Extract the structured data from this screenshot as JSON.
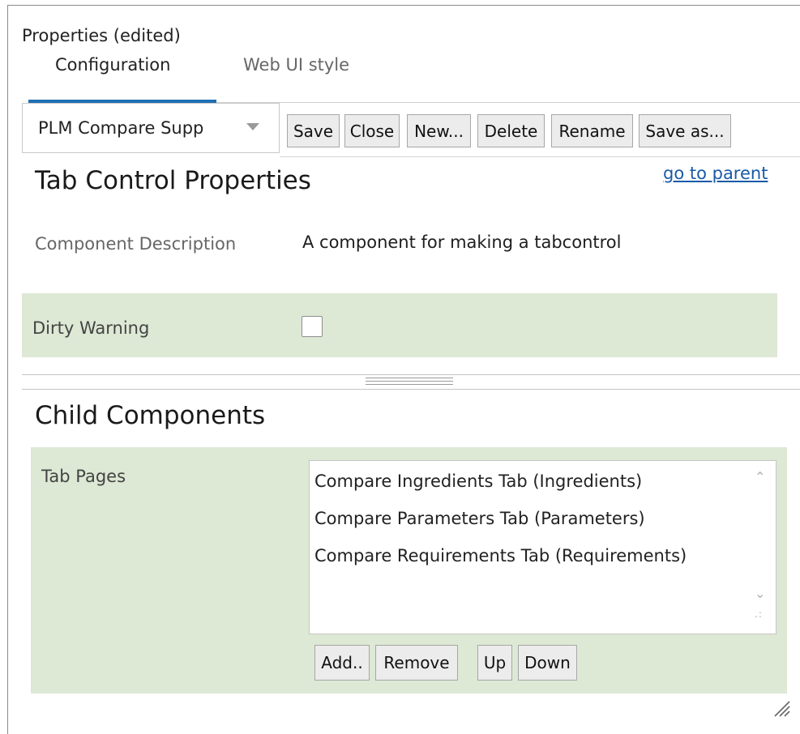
{
  "panel": {
    "title": "Properties (edited)"
  },
  "tabs": [
    {
      "label": "Configuration",
      "active": true
    },
    {
      "label": "Web UI style",
      "active": false
    }
  ],
  "toolbar": {
    "combo_value": "PLM Compare Supp",
    "buttons": [
      "Save",
      "Close",
      "New...",
      "Delete",
      "Rename",
      "Save as..."
    ]
  },
  "properties": {
    "title": "Tab Control Properties",
    "parent_link": "go to parent",
    "component_description_label": "Component Description",
    "component_description_value": "A component for making a tabcontrol",
    "dirty_warning_label": "Dirty Warning",
    "dirty_warning_checked": false
  },
  "children": {
    "title": "Child Components",
    "tab_pages_label": "Tab Pages",
    "items": [
      "Compare Ingredients Tab (Ingredients)",
      "Compare Parameters Tab (Parameters)",
      "Compare Requirements Tab (Requirements)"
    ],
    "buttons": [
      "Add..",
      "Remove",
      "Up",
      "Down"
    ]
  },
  "colors": {
    "accent": "#1f6fb4",
    "section_background": "#dde8d5",
    "link": "#1a5aa6"
  },
  "icons": [
    "dropdown-arrow-icon",
    "scroll-up-icon",
    "scroll-down-icon",
    "resize-grip-icon",
    "splitter-grip-icon"
  ]
}
